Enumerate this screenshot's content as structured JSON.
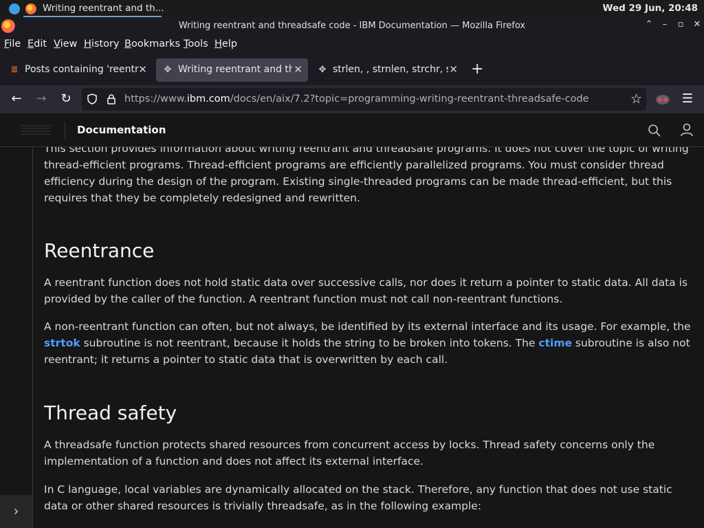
{
  "taskbar": {
    "window_title": "Writing reentrant and th...",
    "clock": "Wed 29 Jun, 20:48"
  },
  "window": {
    "title": "Writing reentrant and threadsafe code - IBM Documentation — Mozilla Firefox"
  },
  "menu": {
    "file": "File",
    "edit": "Edit",
    "view": "View",
    "history": "History",
    "bookmarks": "Bookmarks",
    "tools": "Tools",
    "help": "Help"
  },
  "tabs": [
    {
      "label": "Posts containing 'reentra",
      "icon": "stackoverflow-icon",
      "active": false
    },
    {
      "label": "Writing reentrant and thr",
      "icon": "ibm-icon",
      "active": true
    },
    {
      "label": "strlen, , strnlen, strchr, st",
      "icon": "ibm-icon",
      "active": false
    }
  ],
  "urlbar": {
    "url_prefix": "https://www.",
    "url_host": "ibm.com",
    "url_path": "/docs/en/aix/7.2?topic=programming-writing-reentrant-threadsafe-code"
  },
  "site": {
    "title": "Documentation"
  },
  "article": {
    "intro": "This section provides information about writing reentrant and threadsafe programs. It does not cover the topic of writing thread-efficient programs. Thread-efficient programs are efficiently parallelized programs. You must consider thread efficiency during the design of the program. Existing single-threaded programs can be made thread-efficient, but this requires that they be completely redesigned and rewritten.",
    "h_reentrance": "Reentrance",
    "p_reentrance_1": "A reentrant function does not hold static data over successive calls, nor does it return a pointer to static data. All data is provided by the caller of the function. A reentrant function must not call non-reentrant functions.",
    "p_reentrance_2a": "A non-reentrant function can often, but not always, be identified by its external interface and its usage. For example, the ",
    "link_strtok": "strtok",
    "p_reentrance_2b": " subroutine is not reentrant, because it holds the string to be broken into tokens. The ",
    "link_ctime": "ctime",
    "p_reentrance_2c": " subroutine is also not reentrant; it returns a pointer to static data that is overwritten by each call.",
    "h_threadsafety": "Thread safety",
    "p_threadsafety_1": "A threadsafe function protects shared resources from concurrent access by locks. Thread safety concerns only the implementation of a function and does not affect its external interface.",
    "p_threadsafety_2": "In C language, local variables are dynamically allocated on the stack. Therefore, any function that does not use static data or other shared resources is trivially threadsafe, as in the following example:"
  },
  "colors": {
    "link": "#4f9dff",
    "background": "#161616",
    "tab_active": "#42414d"
  }
}
